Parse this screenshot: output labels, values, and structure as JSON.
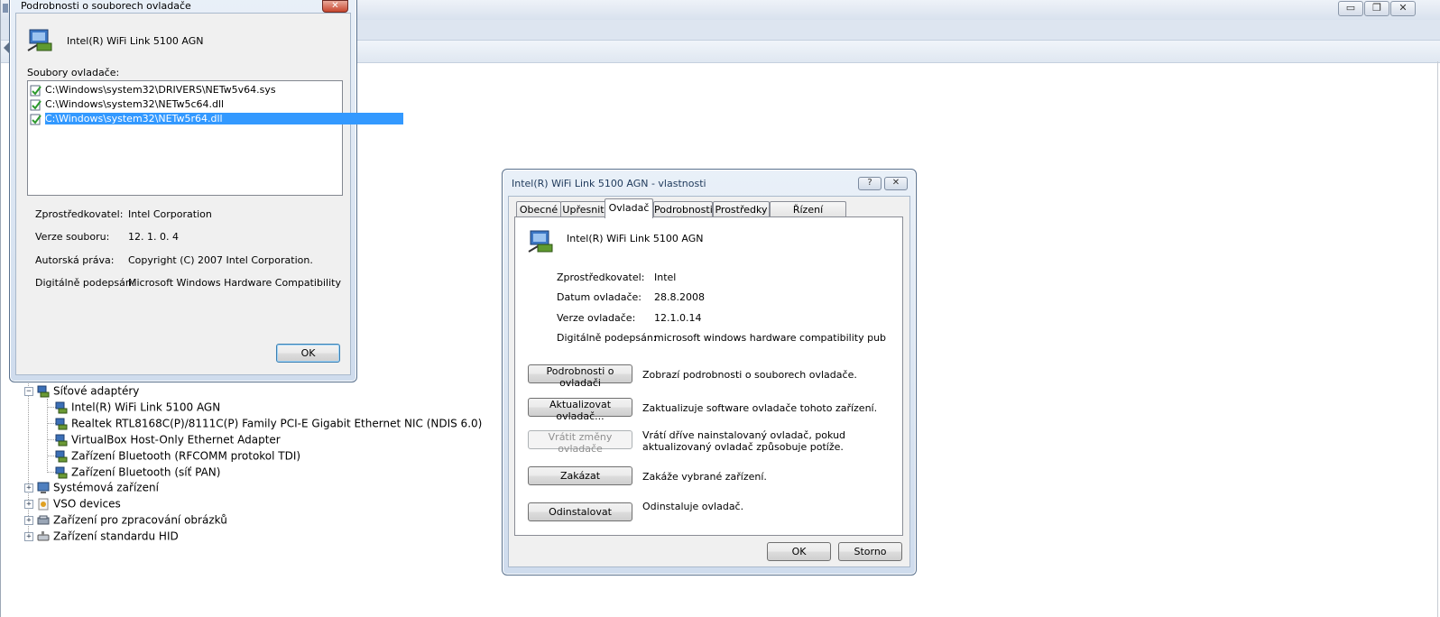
{
  "background_window": {
    "title_buttons": [
      "▭",
      "❐",
      "✕"
    ],
    "tree": {
      "network_adapters": {
        "label": "Síťové adaptéry",
        "children": [
          "Intel(R) WiFi Link 5100 AGN",
          "Realtek RTL8168C(P)/8111C(P) Family PCI-E Gigabit Ethernet NIC (NDIS 6.0)",
          "VirtualBox Host-Only Ethernet Adapter",
          "Zařízení Bluetooth (RFCOMM protokol TDI)",
          "Zařízení Bluetooth (síť PAN)"
        ]
      },
      "collapsed_nodes": [
        "Systémová zařízení",
        "VSO devices",
        "Zařízení pro zpracování obrázků",
        "Zařízení standardu HID"
      ],
      "toggle_collapsed": "+",
      "toggle_expanded": "−"
    }
  },
  "driver_files_dialog": {
    "title": "Podrobnosti o souborech ovladače",
    "close_glyph": "✕",
    "device_name": "Intel(R) WiFi Link 5100 AGN",
    "files_label": "Soubory ovladače:",
    "files": [
      "C:\\Windows\\system32\\DRIVERS\\NETw5v64.sys",
      "C:\\Windows\\system32\\NETw5c64.dll",
      "C:\\Windows\\system32\\NETw5r64.dll"
    ],
    "selected_file_index": 2,
    "details": {
      "provider_label": "Zprostředkovatel:",
      "provider_value": "Intel Corporation",
      "version_label": "Verze souboru:",
      "version_value": "12. 1. 0. 4",
      "copyright_label": "Autorská práva:",
      "copyright_value": "Copyright (C) 2007 Intel Corporation.",
      "signer_label": "Digitálně podepsán:",
      "signer_value": "Microsoft Windows Hardware Compatibility"
    },
    "ok_label": "OK"
  },
  "properties_dialog": {
    "title": "Intel(R) WiFi Link 5100 AGN - vlastnosti",
    "help_glyph": "?",
    "close_glyph": "✕",
    "tabs": [
      "Obecné",
      "Upřesnit",
      "Ovladač",
      "Podrobnosti",
      "Prostředky",
      "Řízení spotřeby"
    ],
    "active_tab": "Ovladač",
    "device_name": "Intel(R) WiFi Link 5100 AGN",
    "info": {
      "provider_label": "Zprostředkovatel:",
      "provider_value": "Intel",
      "date_label": "Datum ovladače:",
      "date_value": "28.8.2008",
      "version_label": "Verze ovladače:",
      "version_value": "12.1.0.14",
      "signer_label": "Digitálně podepsán:",
      "signer_value": "microsoft windows hardware compatibility pub"
    },
    "actions": {
      "details_button": "Podrobnosti o ovladači",
      "details_desc": "Zobrazí podrobnosti o souborech ovladače.",
      "update_button": "Aktualizovat ovladač...",
      "update_desc": "Zaktualizuje software ovladače tohoto zařízení.",
      "rollback_button": "Vrátit změny ovladače",
      "rollback_desc_line1": "Vrátí dříve nainstalovaný ovladač, pokud",
      "rollback_desc_line2": "aktualizovaný ovladač způsobuje potíže.",
      "disable_button": "Zakázat",
      "disable_desc": "Zakáže vybrané zařízení.",
      "uninstall_button": "Odinstalovat",
      "uninstall_desc": "Odinstaluje ovladač."
    },
    "ok_label": "OK",
    "cancel_label": "Storno"
  },
  "colors": {
    "selection": "#3399ff",
    "dialog_bg": "#f0f0f0",
    "frame_border": "#58708d"
  }
}
